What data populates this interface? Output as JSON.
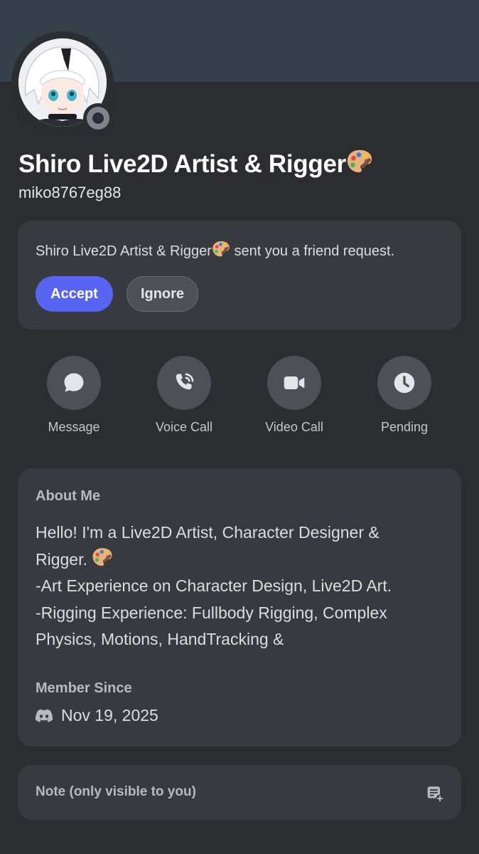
{
  "profile": {
    "display_name": "Shiro Live2D Artist & Rigger",
    "display_emoji": "palette-emoji",
    "username": "miko8767eg88",
    "status": "offline"
  },
  "friend_request": {
    "text": "Shiro Live2D Artist & Rigger",
    "text_suffix": " sent you a friend request.",
    "accept_label": "Accept",
    "ignore_label": "Ignore"
  },
  "actions": [
    {
      "label": "Message",
      "icon": "chat-bubble-icon"
    },
    {
      "label": "Voice Call",
      "icon": "phone-icon"
    },
    {
      "label": "Video Call",
      "icon": "video-camera-icon"
    },
    {
      "label": "Pending",
      "icon": "clock-icon"
    }
  ],
  "about": {
    "title": "About Me",
    "lines": [
      "Hello! I'm a Live2D Artist, Character Designer &",
      "Rigger. ",
      "-Art Experience on Character Design, Live2D Art.",
      "-Rigging Experience: Fullbody Rigging, Complex",
      "Physics, Motions, HandTracking &"
    ]
  },
  "member_since": {
    "title": "Member Since",
    "date": "Nov 19, 2025"
  },
  "note": {
    "placeholder": "Note (only visible to you)"
  },
  "colors": {
    "banner": "#36404b",
    "background": "#2b2d31",
    "card": "#383a40",
    "accept": "#5865f2",
    "action_circle": "#4e5058"
  }
}
